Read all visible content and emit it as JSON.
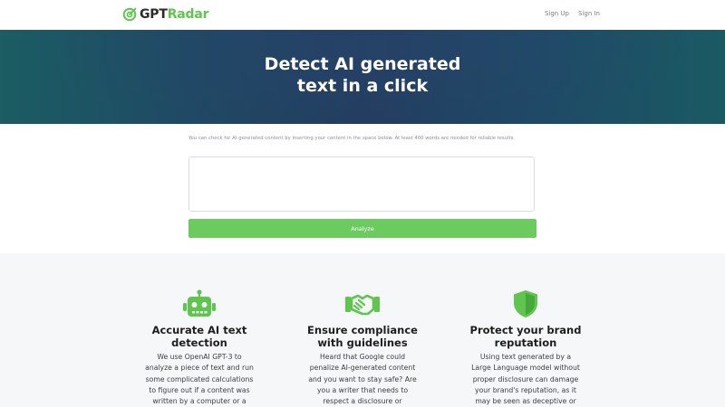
{
  "brand": {
    "name_part1": "GPT",
    "name_part2": "Radar",
    "accent_color": "#5fc54f",
    "logo_icon": "radar-icon"
  },
  "nav": {
    "links": [
      {
        "label": "Sign Up"
      },
      {
        "label": "Sign In"
      }
    ]
  },
  "hero": {
    "title": "Detect AI generated\ntext in a click"
  },
  "checker": {
    "hint": "You can check for AI-generated content by inserting your content in the space below. At least 400 words are needed for reliable results.",
    "input_value": "",
    "analyze_label": "Analyze",
    "button_color": "#6ccb5f"
  },
  "features": [
    {
      "icon": "robot-icon",
      "title": "Accurate AI text\ndetection",
      "body": "We use OpenAI GPT-3 to\nanalyze a piece of text and run\nsome complicated calculations\nto figure out if a content was\nwritten by a computer or a"
    },
    {
      "icon": "handshake-icon",
      "title": "Ensure compliance\nwith guidelines",
      "body": "Heard that Google could\npenalize AI-generated content\nand you want to stay safe? Are\nyou a writer that needs to\nrespect a disclosure or"
    },
    {
      "icon": "shield-icon",
      "title": "Protect your brand\nreputation",
      "body": "Using text generated by a\nLarge Language model without\nproper disclosure can damage\nyour brand's reputation, as it\nmay be seen as deceptive or"
    }
  ]
}
